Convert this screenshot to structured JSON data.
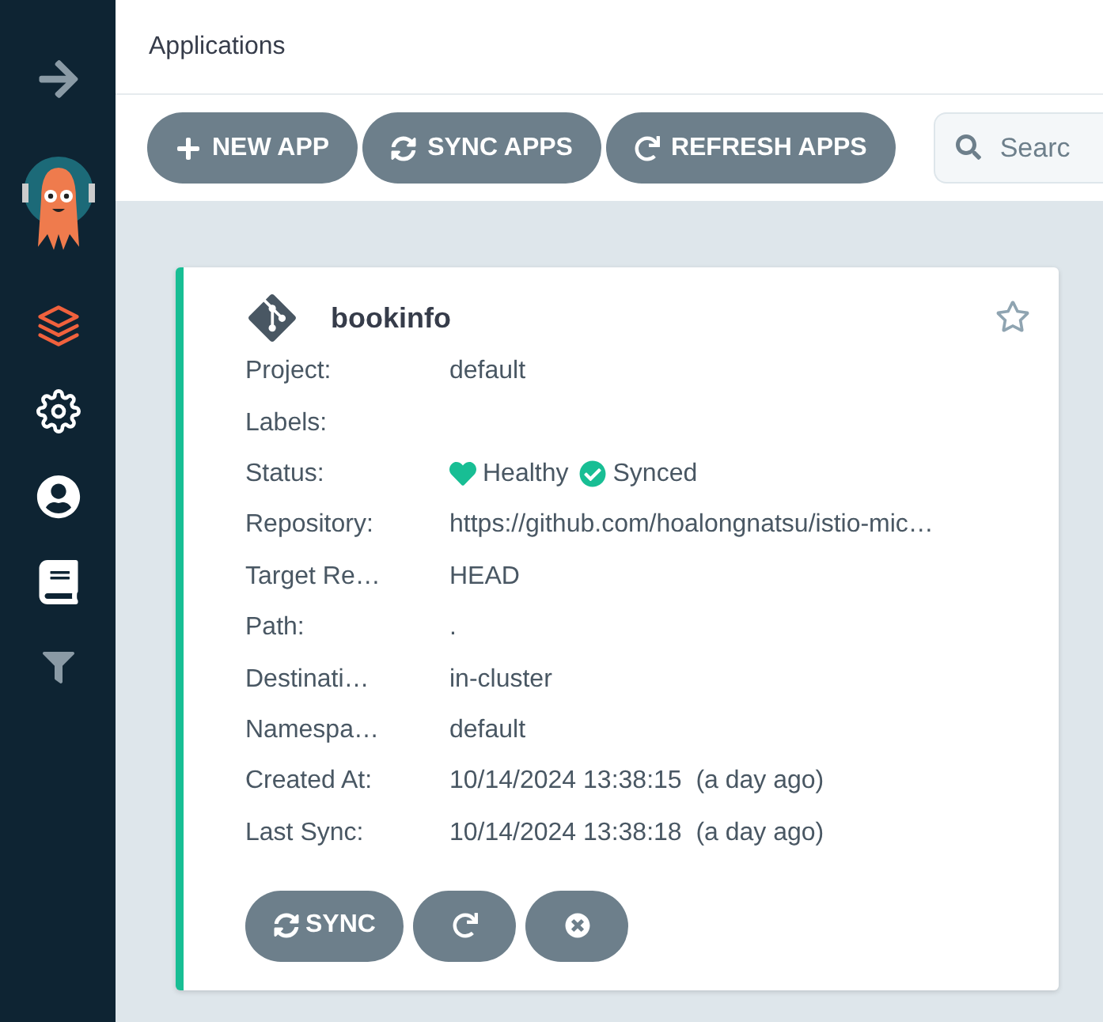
{
  "header": {
    "title": "Applications"
  },
  "sidebar": {
    "items": [
      {
        "kind": "applications",
        "selected": true
      },
      {
        "kind": "settings",
        "selected": false
      },
      {
        "kind": "user",
        "selected": false
      },
      {
        "kind": "docs",
        "selected": false
      }
    ]
  },
  "toolbar": {
    "buttons": [
      {
        "kind": "new",
        "label": "NEW APP"
      },
      {
        "kind": "sync",
        "label": "SYNC APPS"
      },
      {
        "kind": "refresh",
        "label": "REFRESH APPS"
      }
    ],
    "search": {
      "placeholder": "Searc"
    }
  },
  "card": {
    "name": "bookinfo",
    "favorite": false,
    "color": "#18be94",
    "fields": [
      {
        "kind": "text",
        "label": "Project:",
        "value": "default"
      },
      {
        "kind": "text",
        "label": "Labels:"
      },
      {
        "kind": "status",
        "label": "Status:",
        "health": "Healthy",
        "sync": "Synced"
      },
      {
        "kind": "text",
        "label": "Repository:",
        "value": "https://github.com/hoalongnatsu/istio-mic…"
      },
      {
        "kind": "text",
        "label": "Target Re…",
        "value": "HEAD"
      },
      {
        "kind": "text",
        "label": "Path:",
        "value": "."
      },
      {
        "kind": "text",
        "label": "Destinati…",
        "value": "in-cluster"
      },
      {
        "kind": "text",
        "label": "Namespa…",
        "value": "default"
      },
      {
        "kind": "text",
        "label": "Created At:",
        "value": "10/14/2024 13:38:15  (a day ago)"
      },
      {
        "kind": "text",
        "label": "Last Sync:",
        "value": "10/14/2024 13:38:18  (a day ago)"
      }
    ],
    "actions": [
      {
        "kind": "sync",
        "label": "SYNC"
      },
      {
        "kind": "refresh"
      },
      {
        "kind": "delete"
      }
    ]
  }
}
